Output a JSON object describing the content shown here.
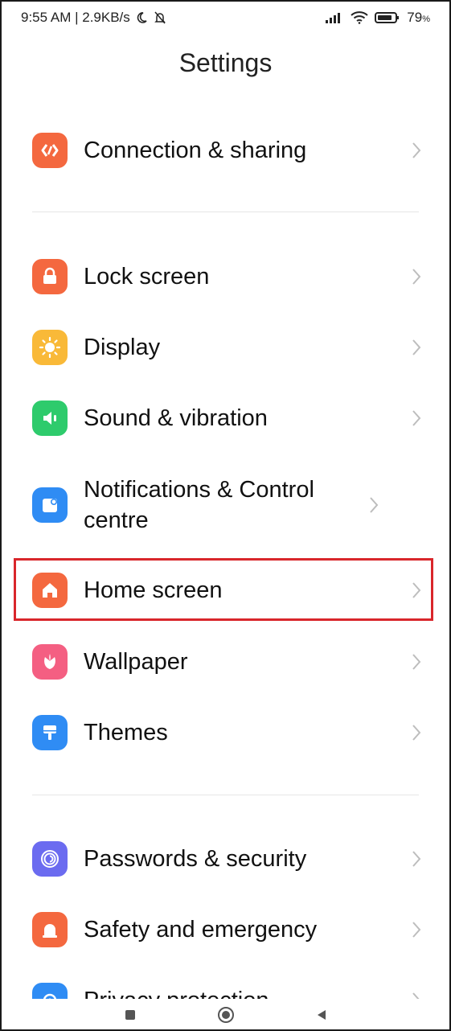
{
  "status_bar": {
    "time_speed": "9:55 AM | 2.9KB/s",
    "battery": "79"
  },
  "header": {
    "title": "Settings"
  },
  "items": [
    {
      "label": "Connection & sharing",
      "color": "#f4683f"
    },
    {
      "label": "Lock screen",
      "color": "#f4683f"
    },
    {
      "label": "Display",
      "color": "#f9b938"
    },
    {
      "label": "Sound & vibration",
      "color": "#2ecb6c"
    },
    {
      "label": "Notifications & Control centre",
      "color": "#2f8cf4"
    },
    {
      "label": "Home screen",
      "color": "#f4683f"
    },
    {
      "label": "Wallpaper",
      "color": "#f45f82"
    },
    {
      "label": "Themes",
      "color": "#2f8cf4"
    },
    {
      "label": "Passwords & security",
      "color": "#6b6bf0"
    },
    {
      "label": "Safety and emergency",
      "color": "#f4683f"
    },
    {
      "label": "Privacy protection",
      "color": "#2f8cf4"
    }
  ]
}
